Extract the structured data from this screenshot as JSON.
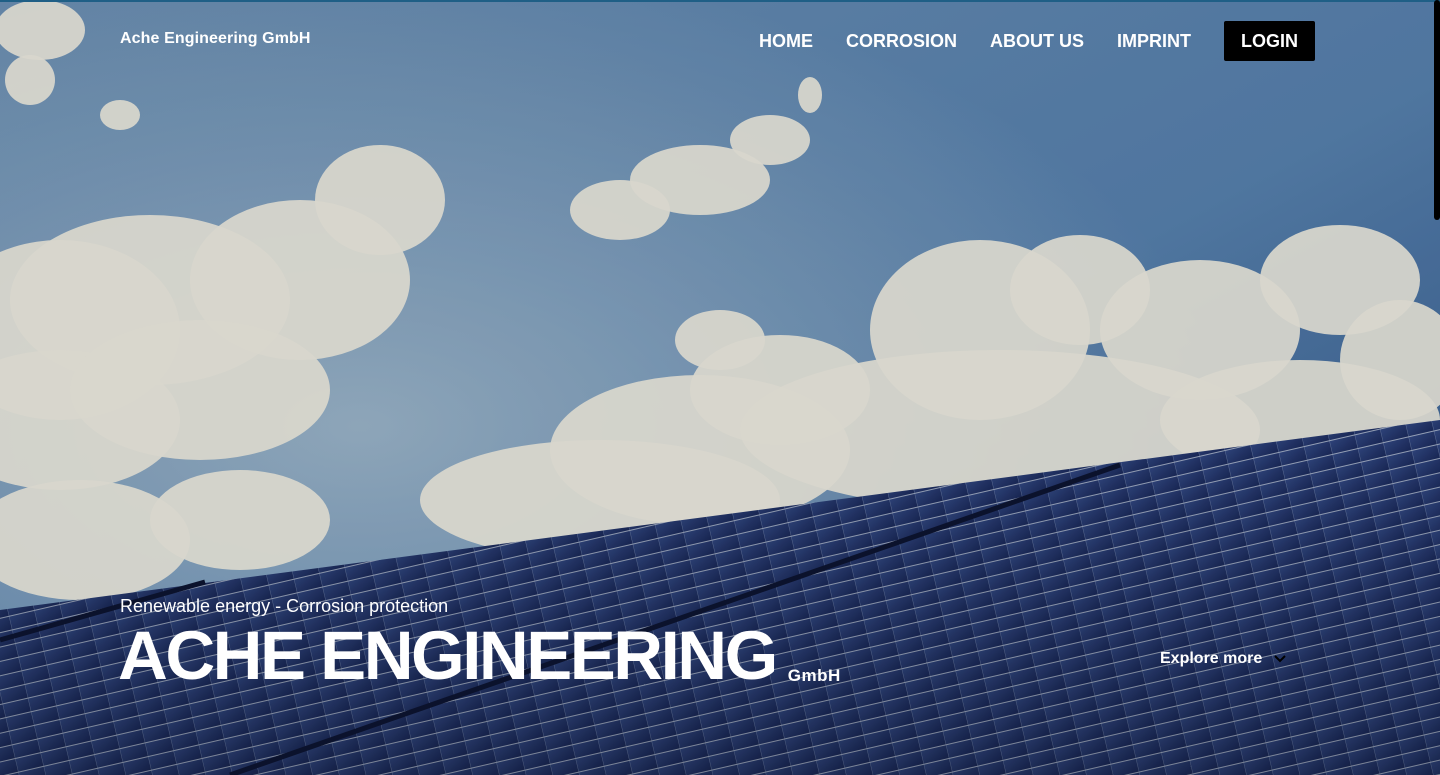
{
  "header": {
    "brand": "Ache Engineering GmbH",
    "nav": [
      {
        "label": "HOME"
      },
      {
        "label": "CORROSION"
      },
      {
        "label": "ABOUT US"
      },
      {
        "label": "IMPRINT"
      }
    ],
    "login_label": "LOGIN"
  },
  "hero": {
    "tagline": "Renewable energy - Corrosion protection",
    "title": "ACHE ENGINEERING",
    "title_suffix": "GmbH",
    "explore_label": "Explore more",
    "explore_icon": "chevron-down-icon",
    "background_image": "sky-with-clouds-and-solar-panels"
  },
  "colors": {
    "sky": "#3e6a9d",
    "panel": "#22305f",
    "login_bg": "#000000",
    "text": "#ffffff"
  }
}
